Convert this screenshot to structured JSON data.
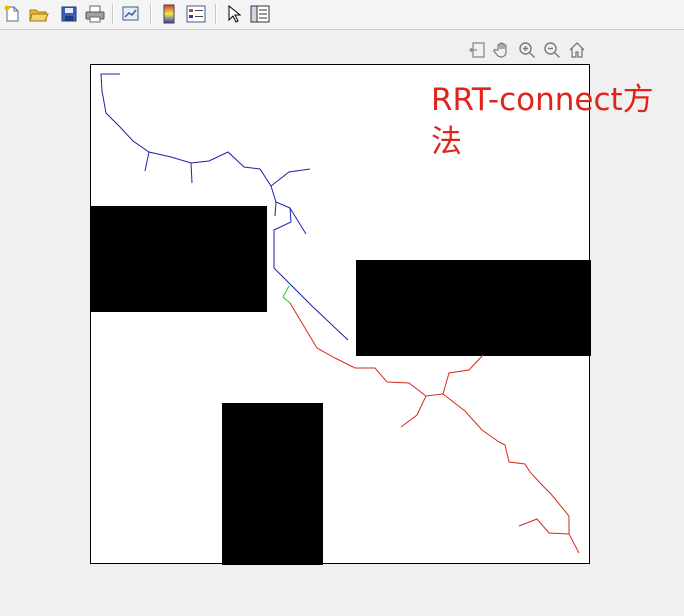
{
  "toolbar": {
    "items": [
      {
        "name": "new-figure-icon"
      },
      {
        "name": "open-file-icon"
      },
      {
        "name": "save-icon"
      },
      {
        "name": "print-icon"
      },
      {
        "name": "link-plot-icon"
      },
      {
        "name": "insert-colorbar-icon"
      },
      {
        "name": "insert-legend-icon"
      },
      {
        "name": "edit-plot-arrow-icon"
      },
      {
        "name": "property-inspector-icon"
      }
    ]
  },
  "axes_toolbar": {
    "items": [
      {
        "name": "export-icon"
      },
      {
        "name": "pan-hand-icon"
      },
      {
        "name": "zoom-in-icon"
      },
      {
        "name": "zoom-out-icon"
      },
      {
        "name": "home-icon"
      }
    ]
  },
  "plot": {
    "title": "RRT-connect方法",
    "colors": {
      "tree_start": "#1f1fb0",
      "tree_goal": "#d42a1e",
      "connection": "#22cc22",
      "obstacle": "#000000",
      "title": "#e0241b"
    }
  }
}
